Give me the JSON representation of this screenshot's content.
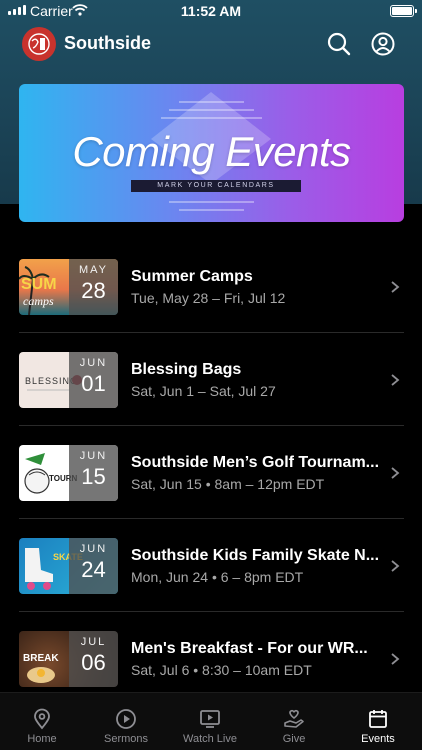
{
  "status_bar": {
    "carrier": "Carrier",
    "time": "11:52 AM"
  },
  "header": {
    "title": "Southside"
  },
  "banner": {
    "title": "Coming Events",
    "subtitle": "MARK YOUR CALENDARS"
  },
  "events": [
    {
      "month": "MAY",
      "day": "28",
      "title": "Summer Camps",
      "subtitle": "Tue, May 28 – Fri, Jul 12",
      "thumb_text": "SUMMER CAMPS"
    },
    {
      "month": "JUN",
      "day": "01",
      "title": "Blessing Bags",
      "subtitle": "Sat, Jun 1 – Sat, Jul 27",
      "thumb_text": "BLESSING BAGS"
    },
    {
      "month": "JUN",
      "day": "15",
      "title": "Southside Men’s Golf Tournam...",
      "subtitle": "Sat, Jun 15 • 8am – 12pm EDT",
      "thumb_text": "TOURNAMENT"
    },
    {
      "month": "JUN",
      "day": "24",
      "title": "Southside Kids Family Skate N...",
      "subtitle": "Mon, Jun 24 • 6 – 8pm EDT",
      "thumb_text": "FAMILY SKATE NIGHT"
    },
    {
      "month": "JUL",
      "day": "06",
      "title": "Men's Breakfast - For our WR...",
      "subtitle": "Sat, Jul 6 • 8:30 – 10am EDT",
      "thumb_text": "BREAKFAST"
    }
  ],
  "tabs": [
    {
      "label": "Home",
      "icon": "location-pin-icon"
    },
    {
      "label": "Sermons",
      "icon": "play-circle-icon"
    },
    {
      "label": "Watch Live",
      "icon": "tv-play-icon"
    },
    {
      "label": "Give",
      "icon": "hand-heart-icon"
    },
    {
      "label": "Events",
      "icon": "calendar-icon"
    }
  ],
  "colors": {
    "header_bg": "#1f4f63",
    "banner_start": "#2fb5f0",
    "banner_end": "#b83ee0",
    "logo": "#c8332d"
  }
}
